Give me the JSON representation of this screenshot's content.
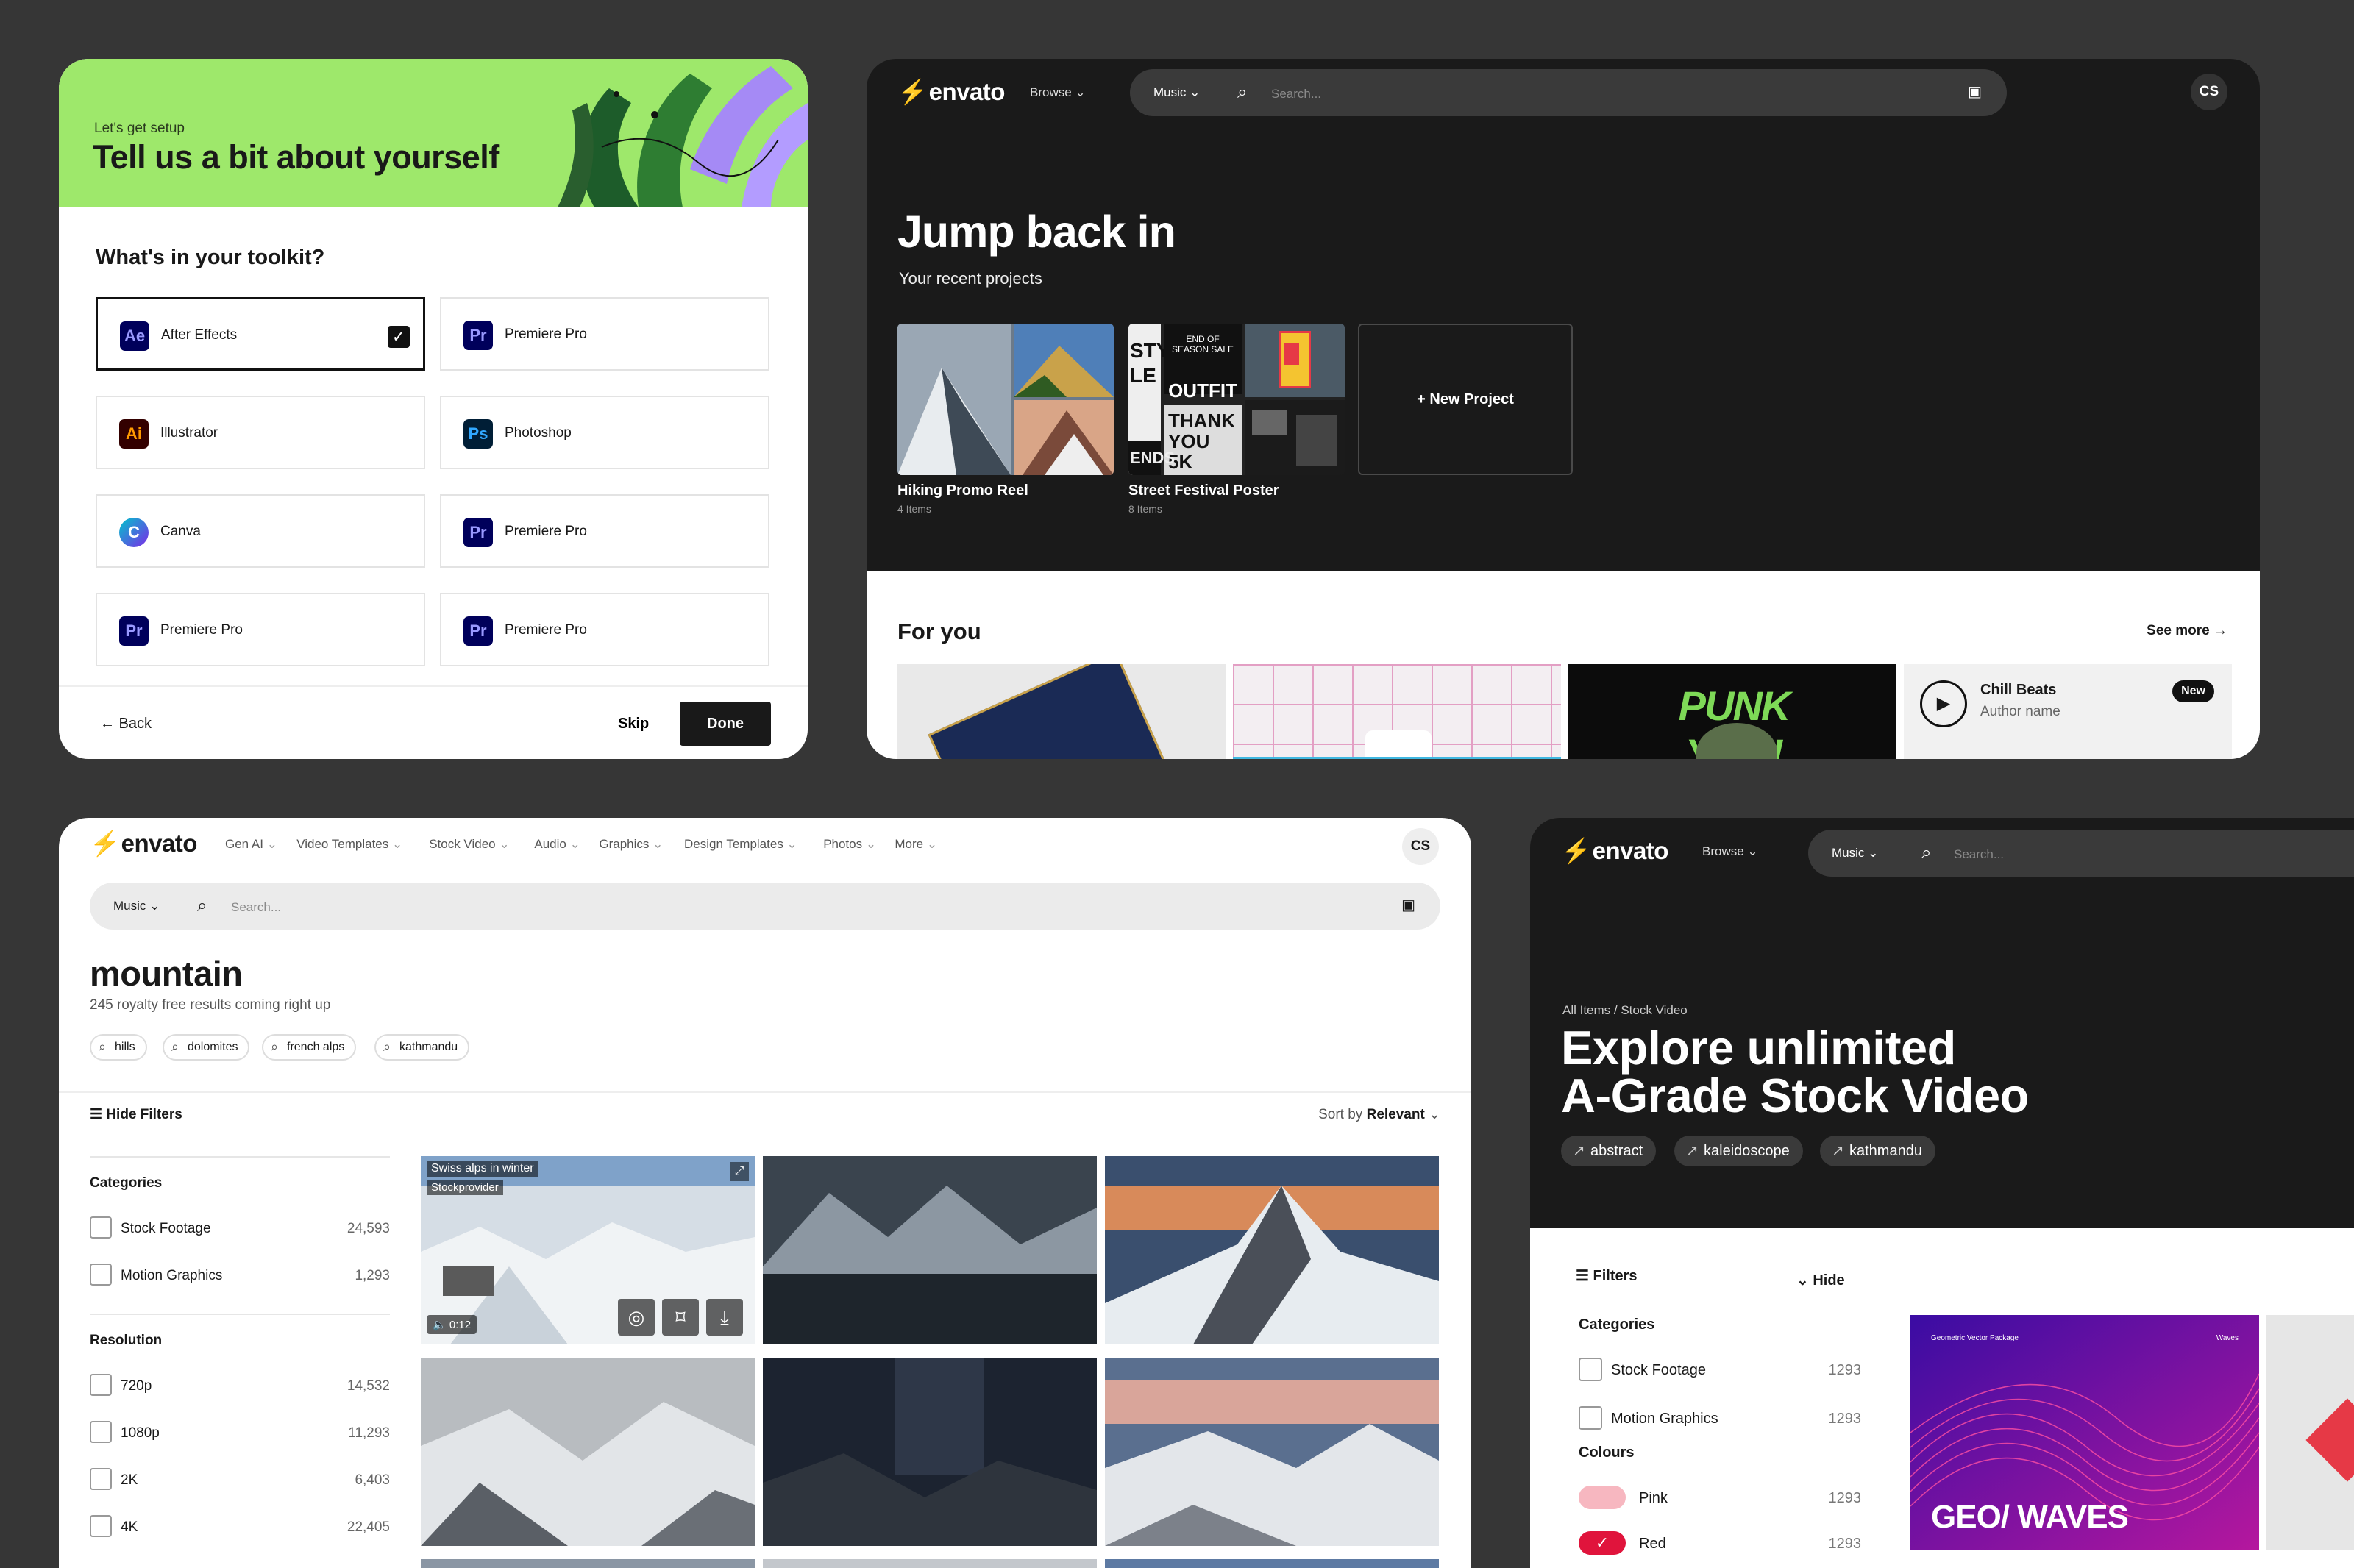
{
  "onboarding": {
    "kicker": "Let's get setup",
    "title": "Tell us a bit about yourself",
    "question": "What's in your toolkit?",
    "tools": [
      {
        "abbr": "Ae",
        "label": "After Effects",
        "selected": true,
        "bg": "#00005b",
        "fg": "#9999ff"
      },
      {
        "abbr": "Pr",
        "label": "Premiere Pro",
        "selected": false,
        "bg": "#00005b",
        "fg": "#9999ff"
      },
      {
        "abbr": "Ai",
        "label": "Illustrator",
        "selected": false,
        "bg": "#330000",
        "fg": "#ff9a00"
      },
      {
        "abbr": "Ps",
        "label": "Photoshop",
        "selected": false,
        "bg": "#001e36",
        "fg": "#31a8ff"
      },
      {
        "abbr": "C",
        "label": "Canva",
        "selected": false,
        "bg": "#7d2ae8",
        "fg": "#ffffff"
      },
      {
        "abbr": "Pr",
        "label": "Premiere Pro",
        "selected": false,
        "bg": "#00005b",
        "fg": "#9999ff"
      },
      {
        "abbr": "Pr",
        "label": "Premiere Pro",
        "selected": false,
        "bg": "#00005b",
        "fg": "#9999ff"
      },
      {
        "abbr": "Pr",
        "label": "Premiere Pro",
        "selected": false,
        "bg": "#00005b",
        "fg": "#9999ff"
      }
    ],
    "back": "← Back",
    "skip": "Skip",
    "done": "Done"
  },
  "brand": {
    "name": "envato",
    "bolt": "⚡",
    "accent": "#87e64b"
  },
  "dashboard": {
    "browse": "Browse ⌄",
    "search_category": "Music ⌄",
    "search_placeholder": "Search...",
    "avatar": "CS",
    "hero": "Jump back in",
    "sub": "Your recent projects",
    "projects": [
      {
        "title": "Hiking Promo Reel",
        "count": "4 Items"
      },
      {
        "title": "Street Festival Poster",
        "count": "8 Items"
      }
    ],
    "new_project": "+ New Project",
    "poster_texts": [
      "STY LE",
      "END OF SEASON SALE",
      "OUTFIT",
      "THANK YOU 5K",
      "ENDS"
    ],
    "for_you": "For you",
    "see_more": "See more →",
    "punk": "PUNK YOU!",
    "card_title": "Chill Beats",
    "card_author": "Author name",
    "card_badge": "New"
  },
  "search_page": {
    "nav": [
      "Gen AI",
      "Video Templates",
      "Stock Video",
      "Audio",
      "Graphics",
      "Design Templates",
      "Photos",
      "More"
    ],
    "search_category": "Music ⌄",
    "search_placeholder": "Search...",
    "avatar": "CS",
    "query": "mountain",
    "count_text": "245 royalty free results coming right up",
    "chips": [
      "hills",
      "dolomites",
      "french alps",
      "kathmandu"
    ],
    "hide_filters": "Hide Filters",
    "sort_label": "Sort by",
    "sort_value": "Relevant",
    "categories_title": "Categories",
    "categories": [
      {
        "label": "Stock Footage",
        "count": "24,593"
      },
      {
        "label": "Motion Graphics",
        "count": "1,293"
      }
    ],
    "resolution_title": "Resolution",
    "resolutions": [
      {
        "label": "720p",
        "count": "14,532"
      },
      {
        "label": "1080p",
        "count": "11,293"
      },
      {
        "label": "2K",
        "count": "6,403"
      },
      {
        "label": "4K",
        "count": "22,405"
      }
    ],
    "featured_title": "Swiss alps in winter",
    "featured_author": "Stockprovider",
    "featured_time": "0:12"
  },
  "explore": {
    "browse": "Browse ⌄",
    "search_category": "Music ⌄",
    "search_placeholder": "Search...",
    "crumb": "All Items / Stock Video",
    "title_line1": "Explore unlimited",
    "title_line2": "A-Grade Stock Video",
    "chips": [
      "abstract",
      "kaleidoscope",
      "kathmandu"
    ],
    "filters": "Filters",
    "hide": "Hide",
    "categories_title": "Categories",
    "categories": [
      {
        "label": "Stock Footage",
        "count": "1293"
      },
      {
        "label": "Motion Graphics",
        "count": "1293"
      }
    ],
    "colours_title": "Colours",
    "colours": [
      {
        "label": "Pink",
        "count": "1293",
        "color": "#f7b7c0",
        "checked": false
      },
      {
        "label": "Red",
        "count": "1293",
        "color": "#e0143c",
        "checked": true
      }
    ],
    "geo_title": "GEO/ WAVES",
    "geo_small_left": "Geometric Vector Package",
    "geo_small_right": "Waves"
  }
}
